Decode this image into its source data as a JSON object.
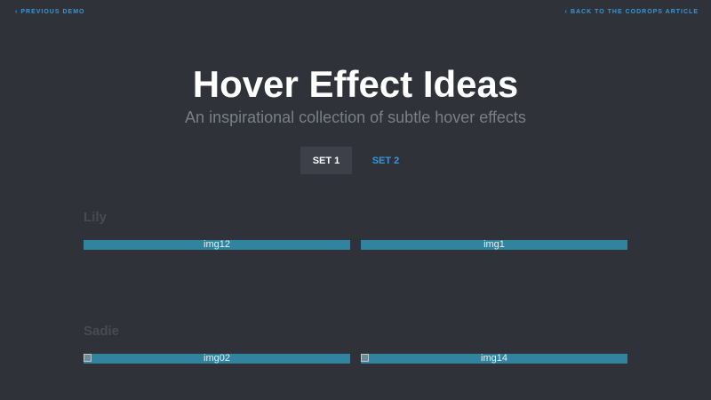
{
  "nav": {
    "previous_demo": "Previous Demo",
    "previous_icon": "arrow-left-icon",
    "back_article": "Back to the Codrops Article",
    "back_icon": "arrow-left-icon"
  },
  "header": {
    "title": "Hover Effect Ideas",
    "subtitle": "An inspirational collection of subtle hover effects"
  },
  "sets": {
    "items": [
      {
        "label": "SET 1",
        "active": true
      },
      {
        "label": "SET 2",
        "active": false
      }
    ]
  },
  "sections": [
    {
      "heading": "Lily",
      "items": [
        {
          "alt": "img12",
          "image_broken": false
        },
        {
          "alt": "img1",
          "image_broken": false
        }
      ]
    },
    {
      "heading": "Sadie",
      "items": [
        {
          "alt": "img02",
          "image_broken": true
        },
        {
          "alt": "img14",
          "image_broken": true
        }
      ]
    }
  ],
  "colors": {
    "background": "#2f3238",
    "accent": "#3498db",
    "tile": "#31849f",
    "heading": "#474b53"
  }
}
